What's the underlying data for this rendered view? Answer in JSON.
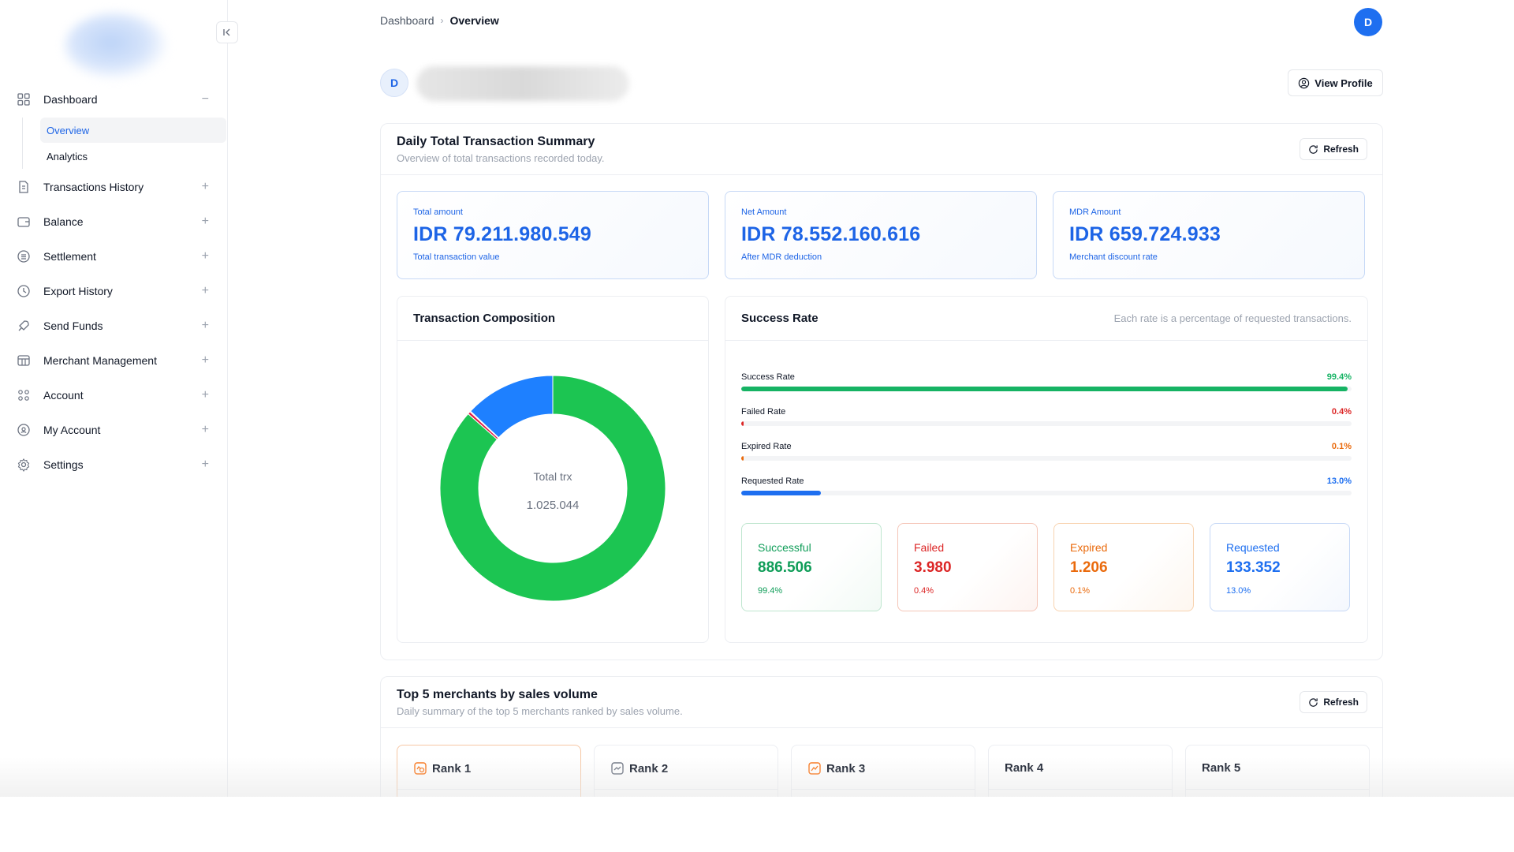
{
  "sidebar": {
    "items": [
      {
        "label": "Dashboard",
        "toggle": "−",
        "icon": "grid-icon"
      },
      {
        "label": "Transactions History",
        "toggle": "+",
        "icon": "receipt-icon"
      },
      {
        "label": "Balance",
        "toggle": "+",
        "icon": "wallet-icon"
      },
      {
        "label": "Settlement",
        "toggle": "+",
        "icon": "list-icon"
      },
      {
        "label": "Export History",
        "toggle": "+",
        "icon": "clock-icon"
      },
      {
        "label": "Send Funds",
        "toggle": "+",
        "icon": "rocket-icon"
      },
      {
        "label": "Merchant Management",
        "toggle": "+",
        "icon": "store-icon"
      },
      {
        "label": "Account",
        "toggle": "+",
        "icon": "users-icon"
      },
      {
        "label": "My Account",
        "toggle": "+",
        "icon": "shield-icon"
      },
      {
        "label": "Settings",
        "toggle": "+",
        "icon": "gear-icon"
      }
    ],
    "dashboard_subitems": [
      {
        "label": "Overview",
        "active": true
      },
      {
        "label": "Analytics",
        "active": false
      }
    ]
  },
  "breadcrumb": {
    "parent": "Dashboard",
    "current": "Overview"
  },
  "header": {
    "avatar_initial": "D"
  },
  "profile": {
    "avatar_initial": "D",
    "view_profile_label": "View Profile"
  },
  "summary": {
    "title": "Daily Total Transaction Summary",
    "subtitle": "Overview of total transactions recorded today.",
    "refresh_label": "Refresh",
    "stats": [
      {
        "label": "Total amount",
        "value": "IDR 79.211.980.549",
        "note": "Total transaction value"
      },
      {
        "label": "Net Amount",
        "value": "IDR 78.552.160.616",
        "note": "After MDR deduction"
      },
      {
        "label": "MDR Amount",
        "value": "IDR 659.724.933",
        "note": "Merchant discount rate"
      }
    ]
  },
  "composition": {
    "title": "Transaction Composition",
    "center_label": "Total trx",
    "center_value": "1.025.044"
  },
  "success_rate": {
    "title": "Success Rate",
    "note": "Each rate is a percentage of requested transactions.",
    "rates": [
      {
        "label": "Success Rate",
        "value": "99.4%",
        "pct": 99.4,
        "color": "#16b364"
      },
      {
        "label": "Failed Rate",
        "value": "0.4%",
        "pct": 0.4,
        "color": "#dc2626"
      },
      {
        "label": "Expired Rate",
        "value": "0.1%",
        "pct": 0.1,
        "color": "#ea6a0c"
      },
      {
        "label": "Requested Rate",
        "value": "13.0%",
        "pct": 13.0,
        "color": "#1e6ff0"
      }
    ],
    "boxes": [
      {
        "label": "Successful",
        "value": "886.506",
        "pct": "99.4%",
        "color": "#0f9d58",
        "border": "#bfe6cf"
      },
      {
        "label": "Failed",
        "value": "3.980",
        "pct": "0.4%",
        "color": "#dc2626",
        "border": "#f5c6b8"
      },
      {
        "label": "Expired",
        "value": "1.206",
        "pct": "0.1%",
        "color": "#ea6a0c",
        "border": "#f8d3b0"
      },
      {
        "label": "Requested",
        "value": "133.352",
        "pct": "13.0%",
        "color": "#1e6ff0",
        "border": "#c7d9f6"
      }
    ]
  },
  "chart_data": {
    "type": "pie",
    "series": [
      {
        "value": 886506,
        "color": "#1cc552"
      },
      {
        "value": 3980,
        "color": "#e11d48"
      },
      {
        "value": 1206,
        "color": "#f97316"
      },
      {
        "value": 133352,
        "color": "#1e80ff"
      }
    ],
    "center_label": "Total trx",
    "center_value": "1.025.044"
  },
  "top5": {
    "title": "Top 5 merchants by sales volume",
    "subtitle": "Daily summary of the top 5 merchants ranked by sales volume.",
    "refresh_label": "Refresh",
    "ranks": [
      {
        "label": "Rank 1",
        "icon": "medal-icon"
      },
      {
        "label": "Rank 2",
        "icon": "trend-icon"
      },
      {
        "label": "Rank 3",
        "icon": "trend-up-icon"
      },
      {
        "label": "Rank 4",
        "icon": ""
      },
      {
        "label": "Rank 5",
        "icon": ""
      }
    ]
  }
}
